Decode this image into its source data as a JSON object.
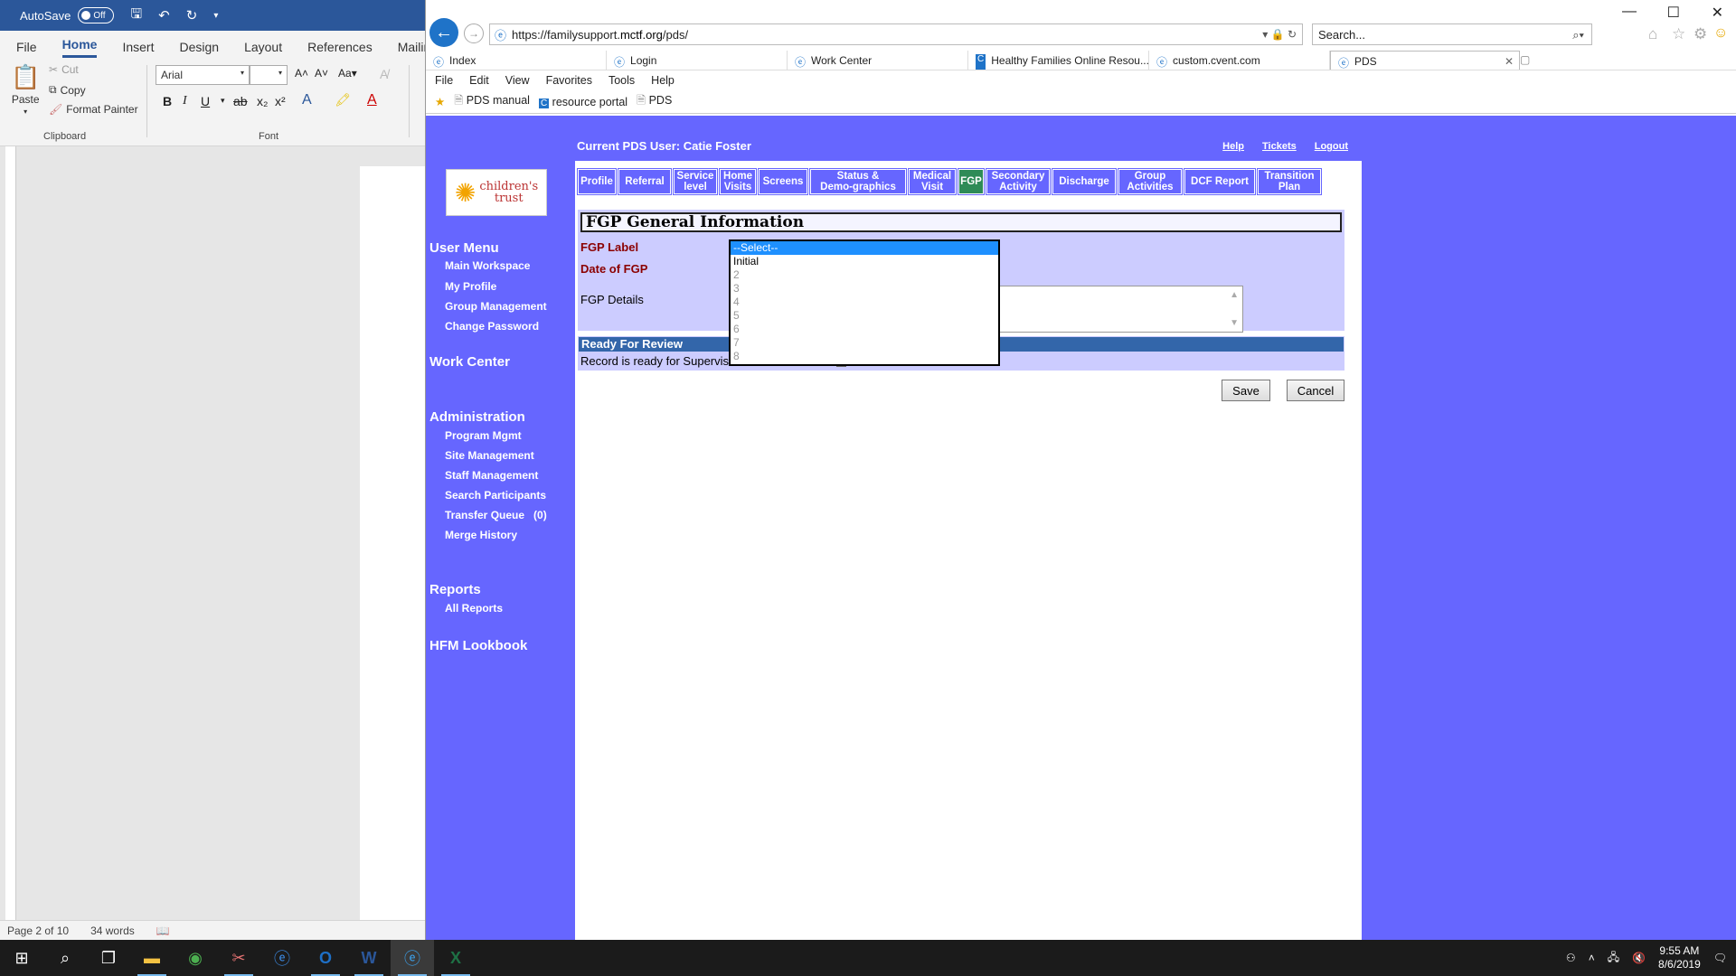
{
  "word": {
    "autosave_label": "AutoSave",
    "autosave_state": "Off",
    "tabs": [
      "File",
      "Home",
      "Insert",
      "Design",
      "Layout",
      "References",
      "Mailings"
    ],
    "clipboard": {
      "paste": "Paste",
      "cut": "Cut",
      "copy": "Copy",
      "format_painter": "Format Painter",
      "group": "Clipboard"
    },
    "font": {
      "name": "Arial",
      "size": "",
      "group": "Font",
      "case": "Aa"
    },
    "status": {
      "page": "Page 2 of 10",
      "words": "34 words"
    }
  },
  "ie": {
    "url_prefix": "https://familysupport.",
    "url_domain": "mctf.org",
    "url_suffix": "/pds/",
    "search_placeholder": "Search...",
    "tabs": [
      {
        "label": "Index",
        "icon": "ie-icon"
      },
      {
        "label": "Login",
        "icon": "ie-icon"
      },
      {
        "label": "Work Center",
        "icon": "ie-icon"
      },
      {
        "label": "Healthy Families Online Resou...",
        "icon": "c-icon"
      },
      {
        "label": "custom.cvent.com",
        "icon": "ie-icon"
      },
      {
        "label": "PDS",
        "icon": "ie-icon"
      }
    ],
    "menu": [
      "File",
      "Edit",
      "View",
      "Favorites",
      "Tools",
      "Help"
    ],
    "favorites": [
      "PDS manual",
      "resource portal",
      "PDS"
    ]
  },
  "pds": {
    "current_user": "Current PDS User: Catie Foster",
    "top_links": {
      "help": "Help",
      "tickets": "Tickets",
      "logout": "Logout"
    },
    "logo_text_1": "children's",
    "logo_text_2": "trust",
    "sidebar": {
      "user_menu": "User Menu",
      "user_items": [
        "Main Workspace",
        "My Profile",
        "Group Management",
        "Change Password"
      ],
      "work_center": "Work Center",
      "administration": "Administration",
      "admin_items": [
        "Program Mgmt",
        "Site Management",
        "Staff Management",
        "Search Participants",
        "Transfer Queue   (0)",
        "Merge History"
      ],
      "reports": "Reports",
      "report_items": [
        "All Reports"
      ],
      "lookbook": "HFM Lookbook"
    },
    "nav_tabs": [
      {
        "l1": "Profile",
        "l2": ""
      },
      {
        "l1": "Referral",
        "l2": ""
      },
      {
        "l1": "Service",
        "l2": "level"
      },
      {
        "l1": "Home",
        "l2": "Visits"
      },
      {
        "l1": "Screens",
        "l2": ""
      },
      {
        "l1": "Status &",
        "l2": "Demo-graphics"
      },
      {
        "l1": "Medical",
        "l2": "Visit"
      },
      {
        "l1": "FGP",
        "l2": ""
      },
      {
        "l1": "Secondary",
        "l2": "Activity"
      },
      {
        "l1": "Discharge",
        "l2": ""
      },
      {
        "l1": "Group",
        "l2": "Activities"
      },
      {
        "l1": "DCF Report",
        "l2": ""
      },
      {
        "l1": "Transition",
        "l2": "Plan"
      }
    ],
    "active_tab": "FGP",
    "form": {
      "heading": "FGP General Information",
      "fgp_label": "FGP Label",
      "date_label": "Date of FGP",
      "details_label": "FGP Details",
      "ready_heading": "Ready For Review",
      "ready_text": "Record is ready for Supervisor Review",
      "save": "Save",
      "cancel": "Cancel"
    },
    "dropdown_options": [
      "--Select--",
      "Initial",
      "2",
      "3",
      "4",
      "5",
      "6",
      "7",
      "8"
    ],
    "dropdown_selected": "--Select--"
  },
  "taskbar": {
    "time": "9:55 AM",
    "date": "8/6/2019"
  },
  "colors": {
    "pds_blue": "#6666ff",
    "active_tab": "#2e8b57",
    "word_blue": "#2b579a"
  }
}
